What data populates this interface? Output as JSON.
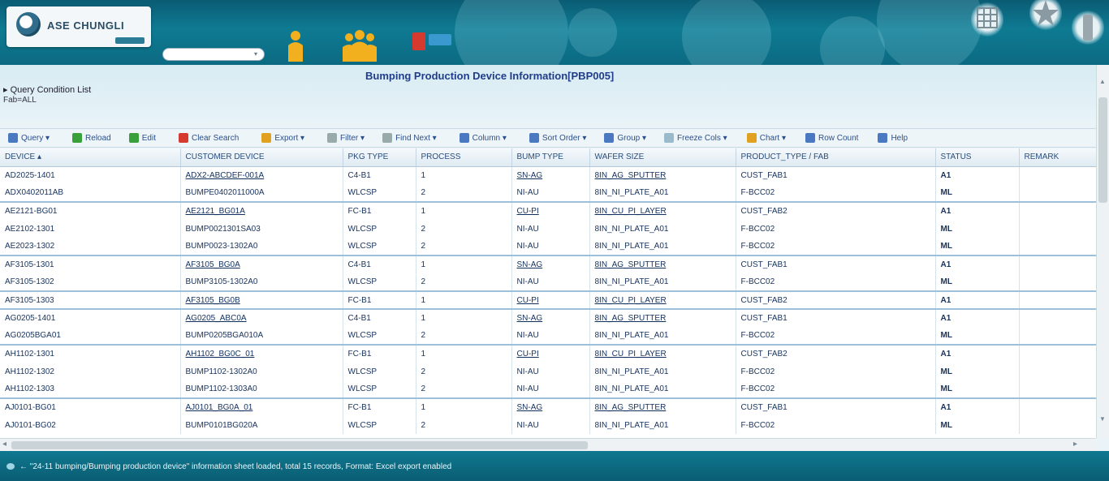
{
  "header": {
    "logo_text": "ASE CHUNGLI",
    "user_select_value": "    ",
    "icons": [
      "user-icon",
      "group-icon",
      "exit-icon",
      "grid-icon",
      "star-icon",
      "info-icon"
    ],
    "colors": {
      "header_bg": "#0e7b93",
      "icon_orange": "#f2b01e",
      "exit_red": "#d63a2f"
    }
  },
  "page": {
    "title": "Bumping Production Device Information[PBP005]",
    "breadcrumb": "▸ Query Condition List",
    "sub_breadcrumb": "Fab=ALL"
  },
  "toolbar": {
    "buttons": [
      {
        "label": "Query ▾",
        "icon": "query-icon",
        "color": "#4a79c2"
      },
      {
        "label": "Reload",
        "icon": "refresh-icon",
        "color": "#3aa03a"
      },
      {
        "label": "Edit",
        "icon": "edit-icon",
        "color": "#3aa03a"
      },
      {
        "label": "Clear Search",
        "icon": "clear-icon",
        "color": "#d63a2f"
      },
      {
        "label": "Export ▾",
        "icon": "export-icon",
        "color": "#e0a020"
      },
      {
        "label": "Filter ▾",
        "icon": "filter-icon",
        "color": "#9aa"
      },
      {
        "label": "Find Next ▾",
        "icon": "find-icon",
        "color": "#9aa"
      },
      {
        "label": "Column ▾",
        "icon": "column-icon",
        "color": "#4a79c2"
      },
      {
        "label": "Sort Order ▾",
        "icon": "sort-icon",
        "color": "#4a79c2"
      },
      {
        "label": "Group ▾",
        "icon": "group-by-icon",
        "color": "#4a79c2"
      },
      {
        "label": "Freeze Cols ▾",
        "icon": "freeze-icon",
        "color": "#9bc"
      },
      {
        "label": "Chart ▾",
        "icon": "chart-icon",
        "color": "#e0a020"
      },
      {
        "label": "Row Count",
        "icon": "count-icon",
        "color": "#4a79c2"
      },
      {
        "label": "Help",
        "icon": "help-icon",
        "color": "#4a79c2"
      }
    ]
  },
  "grid": {
    "headers": [
      "DEVICE ▴",
      "CUSTOMER DEVICE",
      "PKG TYPE",
      "PROCESS",
      "BUMP TYPE",
      "WAFER SIZE",
      "PRODUCT_TYPE / FAB",
      "STATUS",
      "REMARK"
    ],
    "rows": [
      [
        "AD2025-1401",
        "ADX2-ABCDEF-001A",
        "C4-B1",
        "1",
        "SN-AG",
        "8IN_AG_SPUTTER",
        "CUST_FAB1",
        "A1",
        ""
      ],
      [
        "ADX0402011AB",
        "BUMPE0402011000A",
        "WLCSP",
        "2",
        "NI-AU",
        "8IN_NI_PLATE_A01",
        "F-BCC02",
        "ML",
        ""
      ],
      [
        "AE2121-BG01",
        "AE2121_BG01A",
        "FC-B1",
        "1",
        "CU-PI",
        "8IN_CU_PI_LAYER",
        "CUST_FAB2",
        "A1",
        ""
      ],
      [
        "AE2102-1301",
        "BUMP0021301SA03",
        "WLCSP",
        "2",
        "NI-AU",
        "8IN_NI_PLATE_A01",
        "F-BCC02",
        "ML",
        ""
      ],
      [
        "AE2023-1302",
        "BUMP0023-1302A0",
        "WLCSP",
        "2",
        "NI-AU",
        "8IN_NI_PLATE_A01",
        "F-BCC02",
        "ML",
        ""
      ],
      [
        "AF3105-1301",
        "AF3105_BG0A",
        "C4-B1",
        "1",
        "SN-AG",
        "8IN_AG_SPUTTER",
        "CUST_FAB1",
        "A1",
        ""
      ],
      [
        "AF3105-1302",
        "BUMP3105-1302A0",
        "WLCSP",
        "2",
        "NI-AU",
        "8IN_NI_PLATE_A01",
        "F-BCC02",
        "ML",
        ""
      ],
      [
        "AF3105-1303",
        "AF3105_BG0B",
        "FC-B1",
        "1",
        "CU-PI",
        "8IN_CU_PI_LAYER",
        "CUST_FAB2",
        "A1",
        ""
      ],
      [
        "AG0205-1401",
        "AG0205_ABC0A",
        "C4-B1",
        "1",
        "SN-AG",
        "8IN_AG_SPUTTER",
        "CUST_FAB1",
        "A1",
        ""
      ],
      [
        "AG0205BGA01",
        "BUMP0205BGA010A",
        "WLCSP",
        "2",
        "NI-AU",
        "8IN_NI_PLATE_A01",
        "F-BCC02",
        "ML",
        ""
      ],
      [
        "AH1102-1301",
        "AH1102_BG0C_01",
        "FC-B1",
        "1",
        "CU-PI",
        "8IN_CU_PI_LAYER",
        "CUST_FAB2",
        "A1",
        ""
      ],
      [
        "AH1102-1302",
        "BUMP1102-1302A0",
        "WLCSP",
        "2",
        "NI-AU",
        "8IN_NI_PLATE_A01",
        "F-BCC02",
        "ML",
        ""
      ],
      [
        "AH1102-1303",
        "BUMP1102-1303A0",
        "WLCSP",
        "2",
        "NI-AU",
        "8IN_NI_PLATE_A01",
        "F-BCC02",
        "ML",
        ""
      ],
      [
        "AJ0101-BG01",
        "AJ0101_BG0A_01",
        "FC-B1",
        "1",
        "SN-AG",
        "8IN_AG_SPUTTER",
        "CUST_FAB1",
        "A1",
        ""
      ],
      [
        "AJ0101-BG02",
        "BUMP0101BG020A",
        "WLCSP",
        "2",
        "NI-AU",
        "8IN_NI_PLATE_A01",
        "F-BCC02",
        "ML",
        ""
      ]
    ],
    "group_ends": [
      1,
      4,
      6,
      7,
      9,
      12
    ]
  },
  "footer": {
    "text": "← \"24-11 bumping/Bumping production device\" information sheet loaded, total 15 records, Format: Excel export enabled"
  }
}
